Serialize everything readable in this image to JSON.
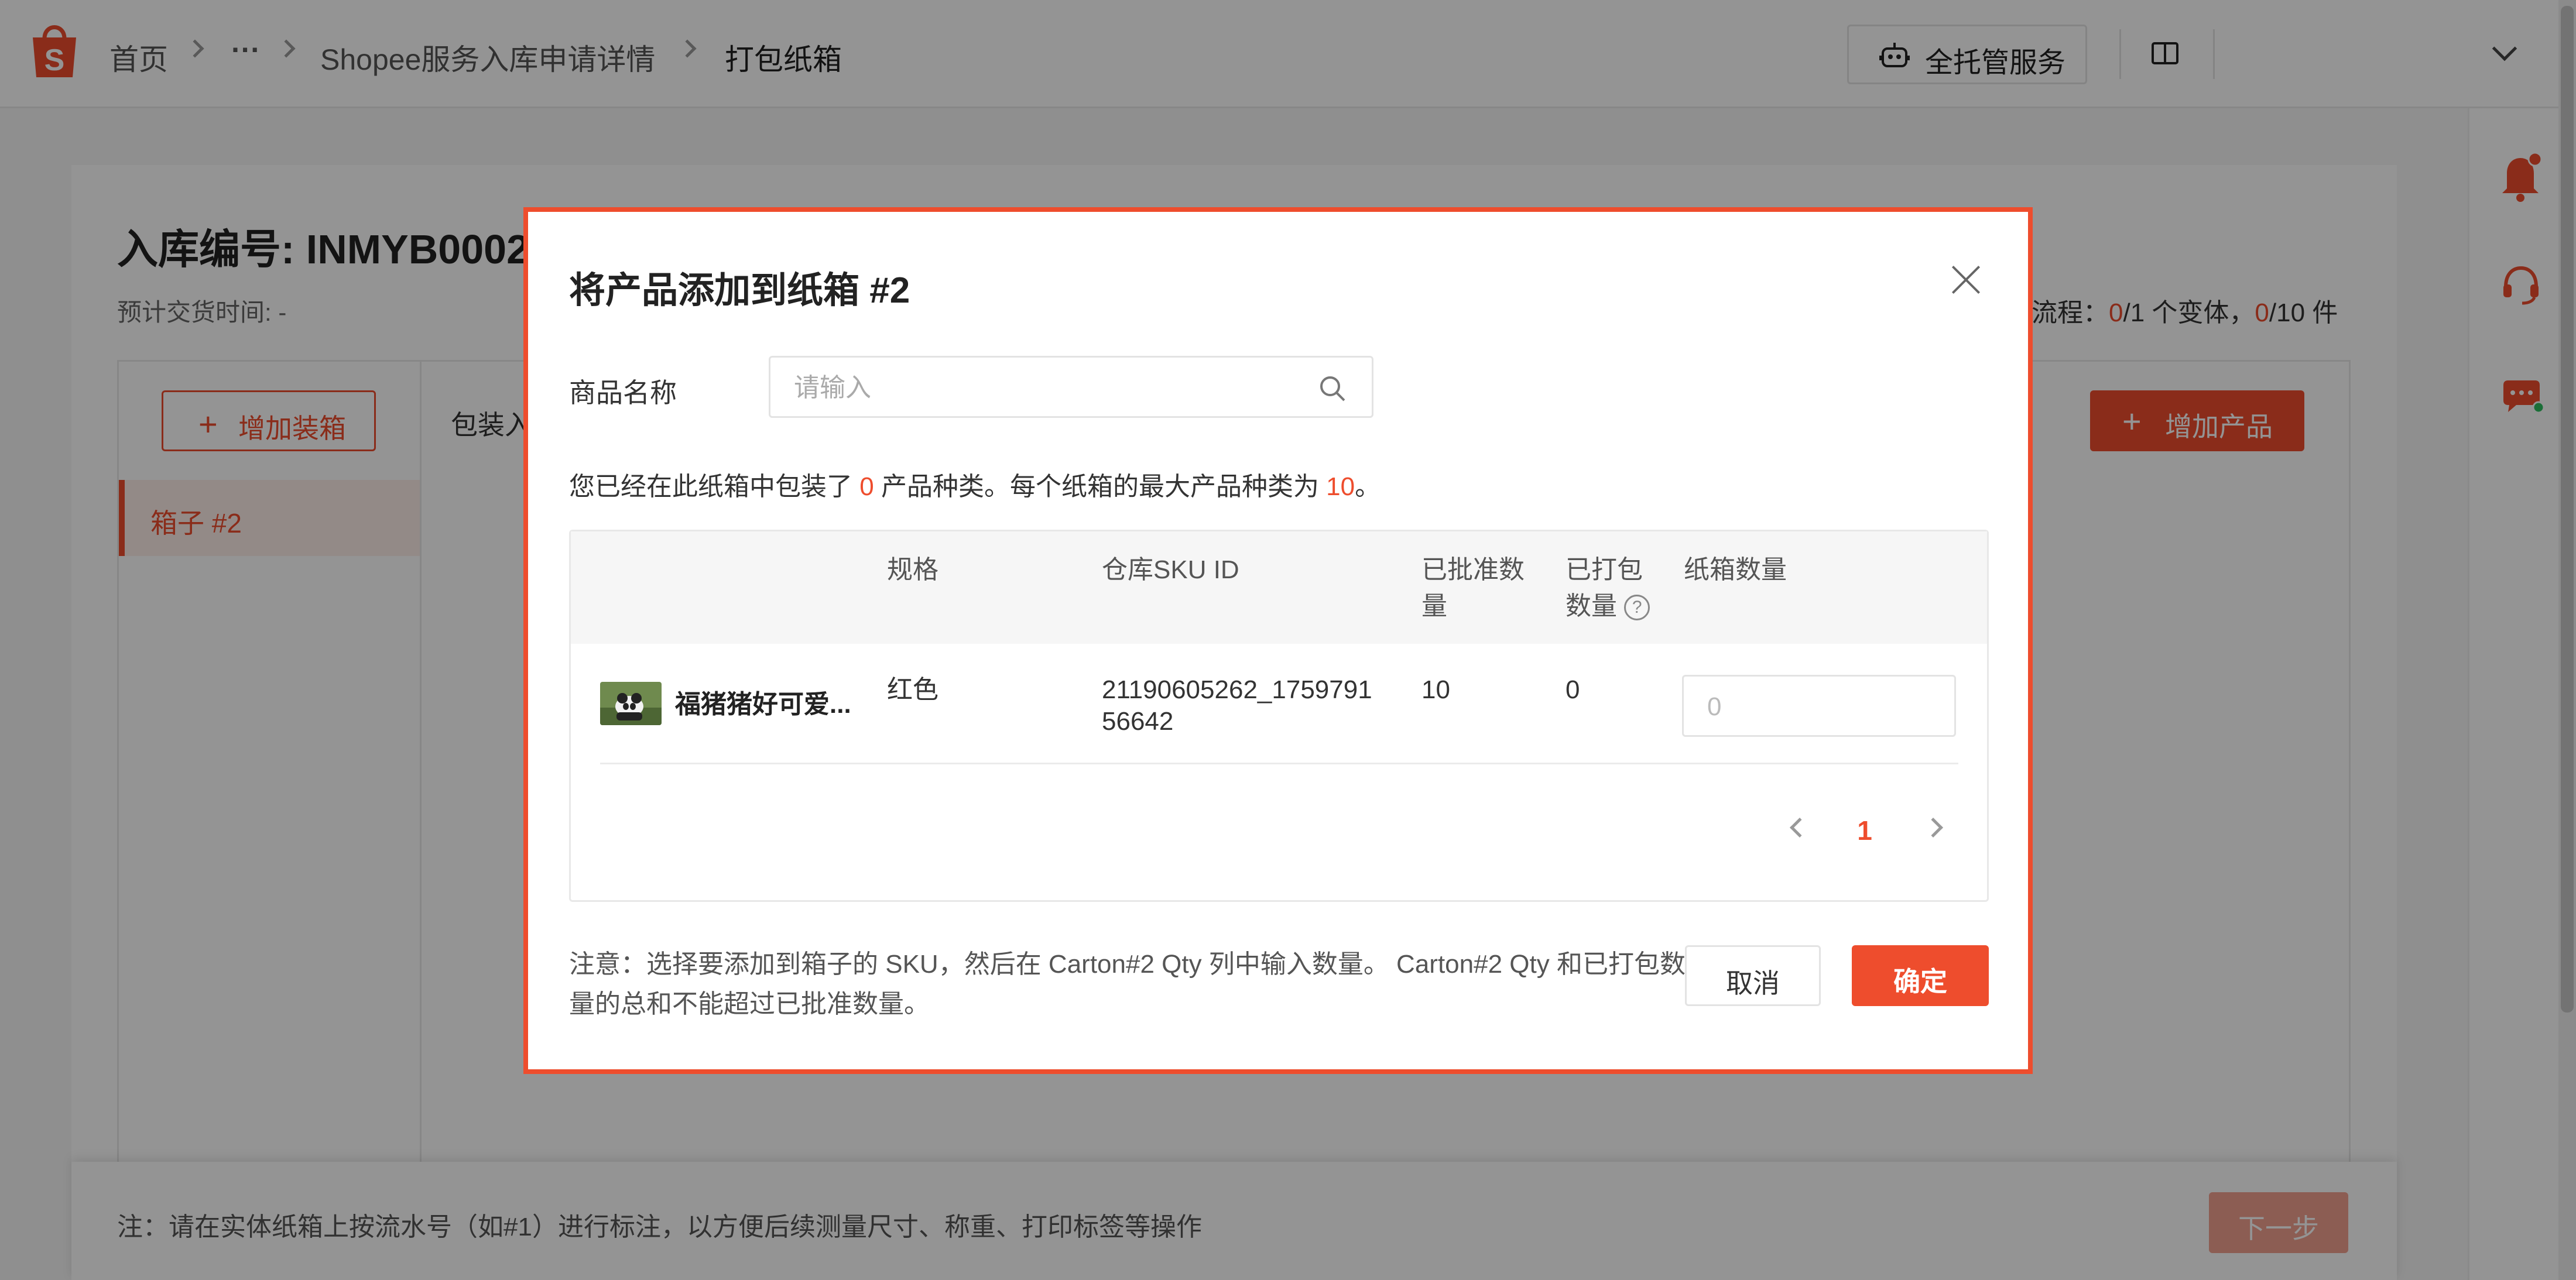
{
  "colors": {
    "brand": "#ee4d2d",
    "overlay": "rgba(0,0,0,0.42)"
  },
  "header": {
    "breadcrumb": {
      "home": "首页",
      "ellipsis": "···",
      "parent": "Shopee服务入库申请详情",
      "current": "打包纸箱"
    },
    "full_service_label": "全托管服务",
    "icons": [
      "shopee-logo-icon",
      "robot-icon",
      "book-icon",
      "chevron-down-icon",
      "bell-icon",
      "headset-icon",
      "chat-icon"
    ]
  },
  "page": {
    "inbound_title": "入库编号: INMYB0002",
    "eta": "预计交货时间: -",
    "flow": {
      "prefix": "流程：",
      "variants_done": "0",
      "variants_total": "/1 个变体，",
      "items_done": "0",
      "items_total": "/10 件"
    },
    "add_box_label": "增加装箱",
    "box_item_label": "箱子 #2",
    "pack_label": "包装入",
    "add_product_label": "增加产品",
    "footer_note": "注：请在实体纸箱上按流水号（如#1）进行标注，以方便后续测量尺寸、称重、打印标签等操作",
    "next_label": "下一步"
  },
  "modal": {
    "title": "将产品添加到纸箱 #2",
    "name_label": "商品名称",
    "search_placeholder": "请输入",
    "info": {
      "part1": "您已经在此纸箱中包装了 ",
      "packed_count": "0",
      "part2": " 产品种类。每个纸箱的最大产品种类为 ",
      "max_count": "10",
      "part3": "。"
    },
    "table": {
      "headers": {
        "spec": "规格",
        "sku": "仓库SKU ID",
        "approved_line1": "已批准数",
        "approved_line2": "量",
        "packed_line1": "已打包",
        "packed_line2": "数量",
        "carton_qty": "纸箱数量"
      },
      "rows": [
        {
          "name": "福猪猪好可爱...",
          "spec": "红色",
          "sku_line1": "21190605262_1759791",
          "sku_line2": "56642",
          "approved": "10",
          "packed": "0",
          "qty_placeholder": "0"
        }
      ]
    },
    "pagination": {
      "current_page": "1"
    },
    "note": "注意：选择要添加到箱子的 SKU，然后在 Carton#2 Qty 列中输入数量。 Carton#2 Qty 和已打包数量的总和不能超过已批准数量。",
    "cancel_label": "取消",
    "confirm_label": "确定"
  }
}
